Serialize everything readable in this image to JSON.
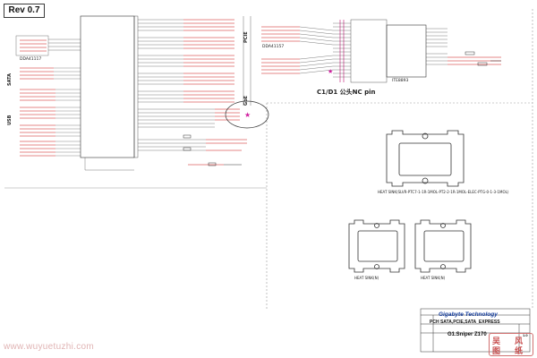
{
  "revision": "Rev 0.7",
  "note": "C1/D1 公头NC pin",
  "title_block": {
    "company": "Gigabyte Technology",
    "title": "PCH SATA,PCIE,SATA_EXPRESS",
    "model": "G1.Sniper Z170",
    "rev": "1.0"
  },
  "watermark": "www.wuyuetuzhi.com",
  "seal": [
    "吴",
    "风",
    "图",
    "纸"
  ],
  "section_labels": [
    "SATA",
    "USB",
    "PCIE",
    "GbE"
  ],
  "part_labels": [
    "DDA41117",
    "DDA41157",
    "ITE8893"
  ],
  "heatsink_captions": {
    "large": "HEAT SINK(SLVR-PTC7-1-1R-1MOL-PT2-2-1R-1MOL-ELEC-PTG-0-1-3-1MOL)",
    "small_left": "HEAT SINK(N)",
    "small_right": "HEAT SINK(N)"
  },
  "colors": {
    "wire": "#444444",
    "net_red": "#cc1010",
    "component": "#333333",
    "title_blue": "#123b9c",
    "seal": "#c85050",
    "highlight": "#d01f9f"
  }
}
